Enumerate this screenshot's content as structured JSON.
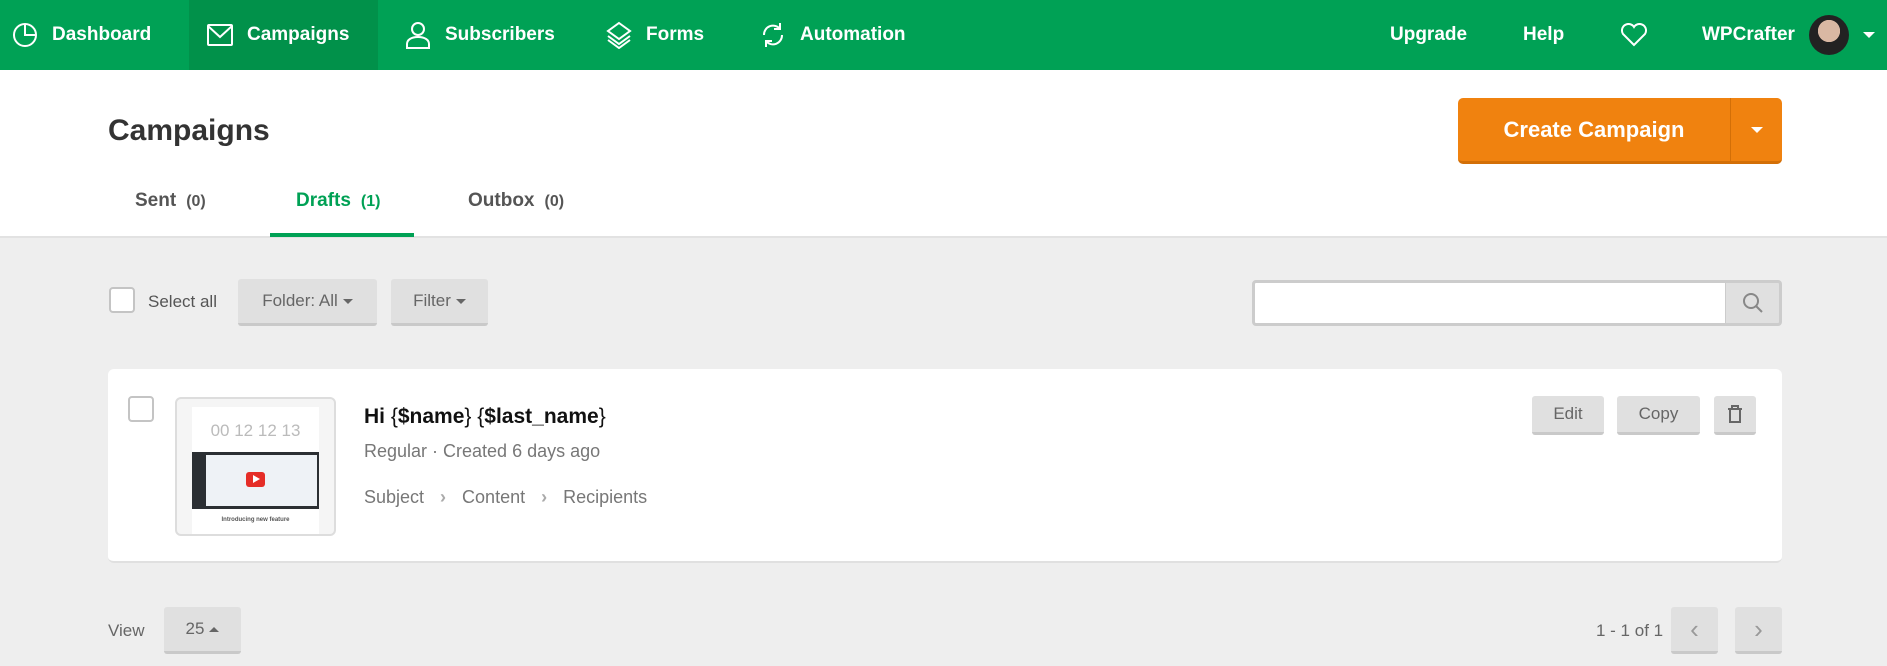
{
  "nav": {
    "items": [
      {
        "label": "Dashboard",
        "icon": "pie-chart-icon"
      },
      {
        "label": "Campaigns",
        "icon": "envelope-icon",
        "active": true
      },
      {
        "label": "Subscribers",
        "icon": "user-icon"
      },
      {
        "label": "Forms",
        "icon": "layers-icon"
      },
      {
        "label": "Automation",
        "icon": "refresh-icon"
      }
    ],
    "upgrade": "Upgrade",
    "help": "Help",
    "user": "WPCrafter"
  },
  "header": {
    "title": "Campaigns",
    "create_label": "Create Campaign",
    "tabs": [
      {
        "label": "Sent",
        "count": "(0)"
      },
      {
        "label": "Drafts",
        "count": "(1)",
        "active": true
      },
      {
        "label": "Outbox",
        "count": "(0)"
      }
    ]
  },
  "toolbar": {
    "select_all": "Select all",
    "folder": "Folder: All",
    "filter": "Filter",
    "search_placeholder": ""
  },
  "campaigns": [
    {
      "title_prefix": "Hi ",
      "title_parts": [
        "{",
        "$name",
        "}",
        "{",
        "$last_name",
        "}"
      ],
      "meta": "Regular · Created 6 days ago",
      "steps": [
        "Subject",
        "Content",
        "Recipients"
      ],
      "thumb_counter": "00 12 12 13",
      "thumb_caption": "Introducing new feature",
      "edit": "Edit",
      "copy": "Copy"
    }
  ],
  "footer": {
    "view_label": "View",
    "per_page": "25",
    "range": "1 - 1 of 1"
  },
  "colors": {
    "nav": "#00a155",
    "accent": "#00a155",
    "create": "#f0820f"
  }
}
